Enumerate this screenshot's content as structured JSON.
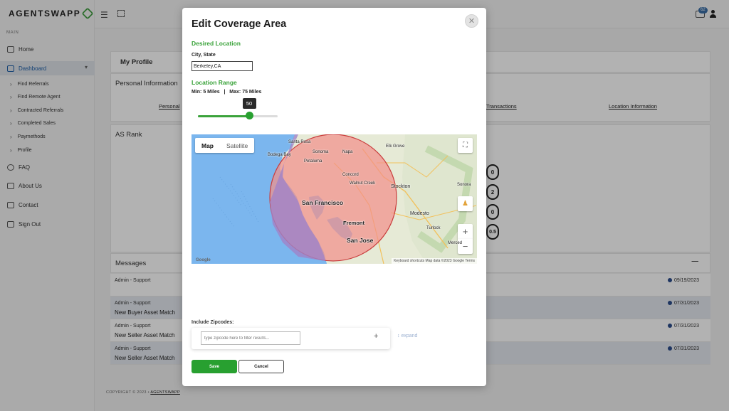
{
  "app": {
    "logo_text": "AGENTSWAPP"
  },
  "sidebar": {
    "section_label": "MAIN",
    "items": [
      {
        "label": "Home"
      },
      {
        "label": "Dashboard"
      },
      {
        "label": "FAQ"
      },
      {
        "label": "About Us"
      },
      {
        "label": "Contact"
      },
      {
        "label": "Sign Out"
      }
    ],
    "subitems": [
      {
        "label": "Find Referrals"
      },
      {
        "label": "Find Remote Agent"
      },
      {
        "label": "Contracted Referrals"
      },
      {
        "label": "Completed Sales"
      },
      {
        "label": "Paymethods"
      },
      {
        "label": "Profile"
      }
    ]
  },
  "topbar": {
    "inbox_badge": "62"
  },
  "profile": {
    "title": "My Profile",
    "personal_info_heading": "Personal Information",
    "tab_personal": "Personal",
    "tab_transactions": "Transactions",
    "tab_location": "Location Information",
    "as_rank_heading": "AS Rank",
    "rank_values": [
      "0",
      "2",
      "0",
      "0.5"
    ]
  },
  "messages": {
    "heading": "Messages",
    "collapse_symbol": "—",
    "rows": [
      {
        "sender": "Admin - Support",
        "subject": "",
        "date": "09/19/2023"
      },
      {
        "sender": "Admin - Support",
        "subject": "New Buyer Asset Match",
        "date": "07/31/2023"
      },
      {
        "sender": "Admin - Support",
        "subject": "New Seller Asset Match",
        "date": "07/31/2023"
      },
      {
        "sender": "Admin - Support",
        "subject": "New Seller Asset Match",
        "date": "07/31/2023"
      }
    ]
  },
  "footer": {
    "copyright": "COPYRIGHT © 2023 •",
    "brand_link": "AGENTSWAPP"
  },
  "modal": {
    "title": "Edit Coverage Area",
    "close_symbol": "✕",
    "desired_location_heading": "Desired Location",
    "city_state_label": "City, State",
    "city_state_value": "Berkeley,CA",
    "location_range_heading": "Location Range",
    "range_text": "Min: 5 Miles   |   Max: 75 Miles",
    "slider": {
      "min": 5,
      "max": 75,
      "value": 50
    },
    "slider_value_label": "50",
    "map": {
      "map_tab": "Map",
      "satellite_tab": "Satellite",
      "zoom_in": "+",
      "zoom_out": "−",
      "google_logo": "Google",
      "attribution": "Keyboard shortcuts    Map data ©2023 Google    Terms",
      "cities": [
        "Santa Rosa",
        "Petaluma",
        "Napa",
        "Sonoma",
        "Elk Grove",
        "Concord",
        "Walnut Creek",
        "Stockton",
        "San Francisco",
        "Fremont",
        "San Jose",
        "Modesto",
        "Turlock",
        "Merced",
        "Sonora",
        "Bodega Bay"
      ]
    },
    "include_zipcodes_label": "Include Zipcodes:",
    "zip_placeholder": "type zipcode here to filter results...",
    "zip_add_symbol": "+",
    "expand_label": "expand",
    "save_label": "Save",
    "cancel_label": "Cancel"
  }
}
